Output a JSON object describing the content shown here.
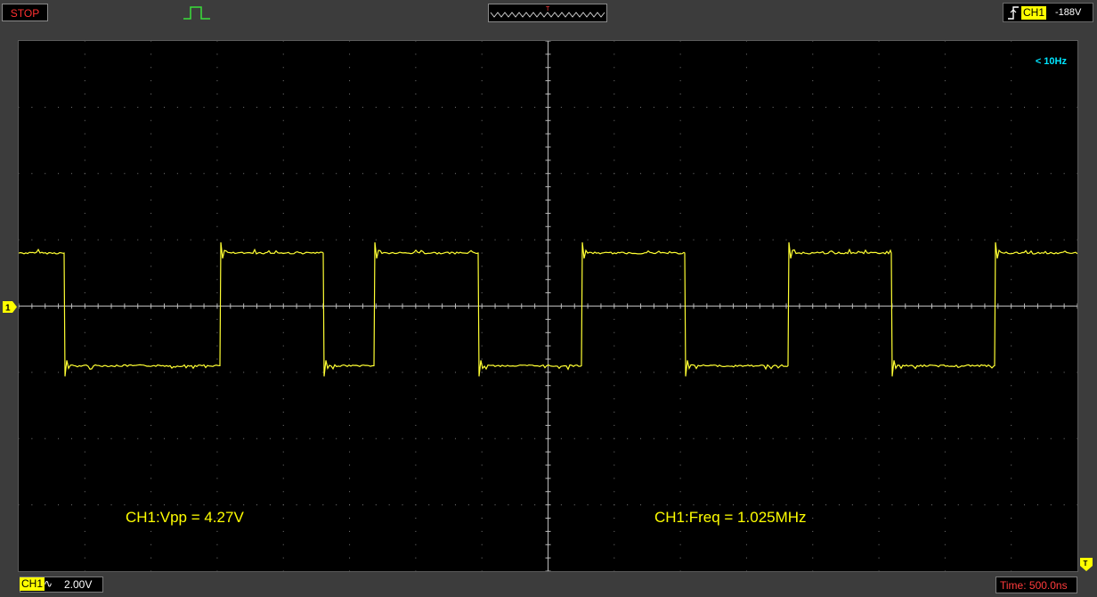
{
  "status": {
    "run_state": "STOP",
    "run_state_color": "#ff3030"
  },
  "trigger": {
    "source": "CH1",
    "level": "-188V",
    "edge_icon": "rising-edge-trigger-icon",
    "position_marker": "T"
  },
  "screen": {
    "low_freq_warning": "< 10Hz",
    "measurements": {
      "vpp": "CH1:Vpp = 4.27V",
      "freq": "CH1:Freq = 1.025MHz"
    },
    "channel_marker": "1",
    "trigger_marker": "T",
    "grid": {
      "h_divisions": 16,
      "v_divisions": 8
    }
  },
  "bottom": {
    "channel": "CH1",
    "coupling": "∿",
    "volts_per_div": "2.00V",
    "timebase": "Time: 500.0ns"
  },
  "colors": {
    "trace": "#ffff33",
    "ch1_badge": "#ffff00",
    "timebase_text": "#ff3b3b",
    "warning_text": "#00e5ff"
  },
  "waveform": {
    "frequency": "1.025MHz",
    "vpp": "4.27V",
    "high_level_div": 0.8,
    "low_level_div": -0.9,
    "timebase_per_div": "500.0ns"
  }
}
